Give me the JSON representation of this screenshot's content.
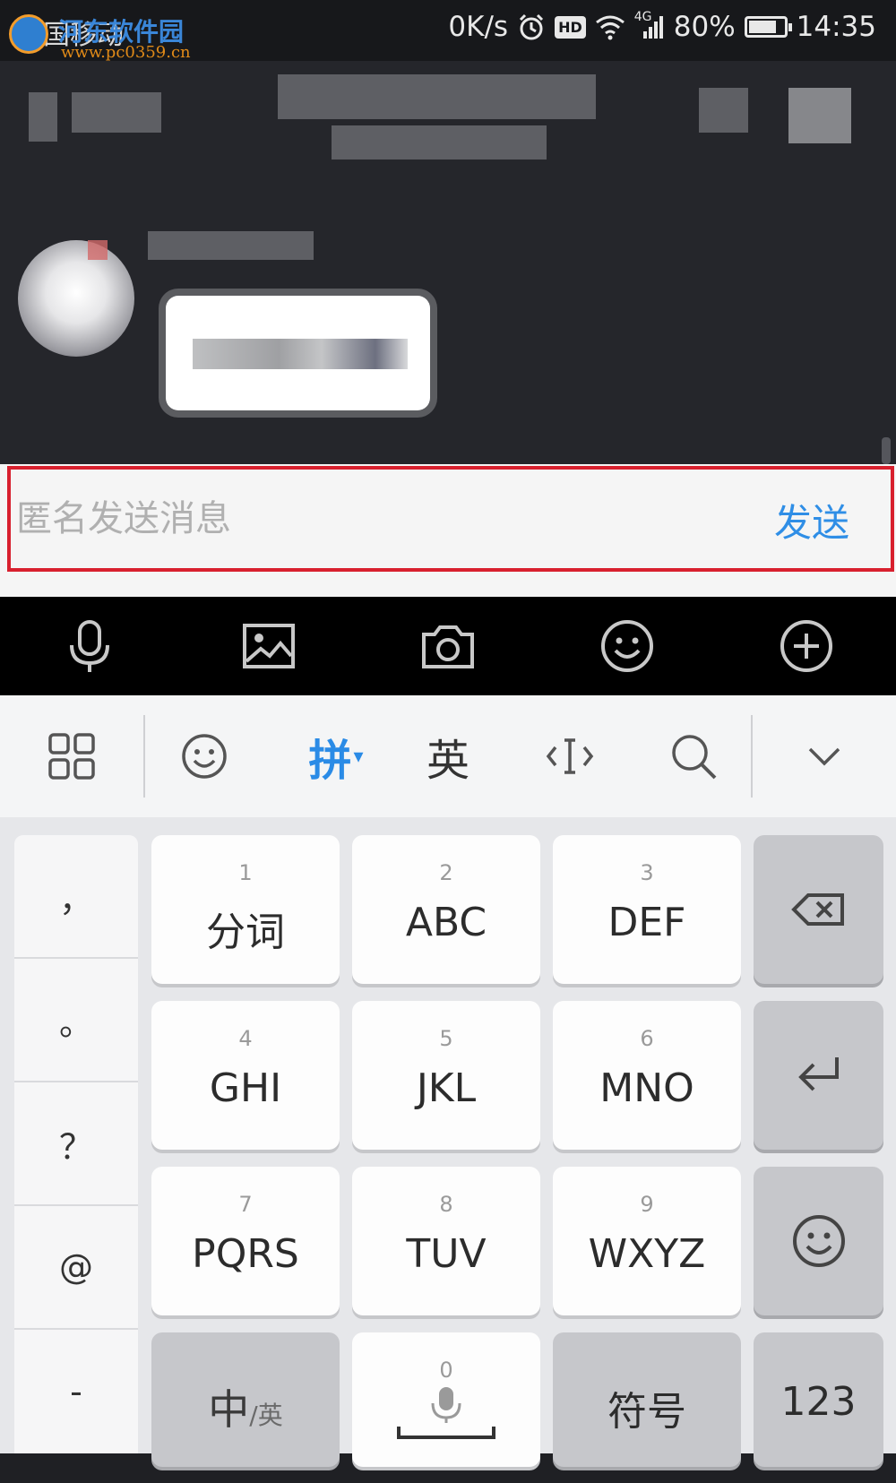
{
  "status_bar": {
    "carrier": "中国移动",
    "watermark_name": "河东软件园",
    "watermark_url": "www.pc0359.cn",
    "net_speed": "0K/s",
    "hd_badge": "HD",
    "network": "4G",
    "battery": "80%",
    "battery_level": 0.8,
    "time": "14:35"
  },
  "input_bar": {
    "placeholder": "匿名发送消息",
    "send_label": "发送",
    "highlight_color": "#d8202e"
  },
  "toolbar": {
    "icons": [
      "microphone-icon",
      "image-icon",
      "camera-icon",
      "emoji-icon",
      "plus-icon"
    ]
  },
  "keyboard": {
    "top_bar": {
      "pinyin_label": "拼",
      "pinyin_caret": "▾",
      "english_label": "英"
    },
    "punctuation": [
      "，",
      "。",
      "？",
      "@",
      "-"
    ],
    "keys": [
      {
        "num": "1",
        "label": "分词"
      },
      {
        "num": "2",
        "label": "ABC"
      },
      {
        "num": "3",
        "label": "DEF"
      },
      {
        "num": "4",
        "label": "GHI"
      },
      {
        "num": "5",
        "label": "JKL"
      },
      {
        "num": "6",
        "label": "MNO"
      },
      {
        "num": "7",
        "label": "PQRS"
      },
      {
        "num": "8",
        "label": "TUV"
      },
      {
        "num": "9",
        "label": "WXYZ"
      }
    ],
    "bottom": {
      "lang_main": "中",
      "lang_sub": "/英",
      "space_num": "0",
      "symbol_label": "符号",
      "numeric_label": "123"
    }
  },
  "colors": {
    "accent": "#2a8be6",
    "chat_bg": "#25262b",
    "keyboard_bg": "#e6e7ea"
  }
}
